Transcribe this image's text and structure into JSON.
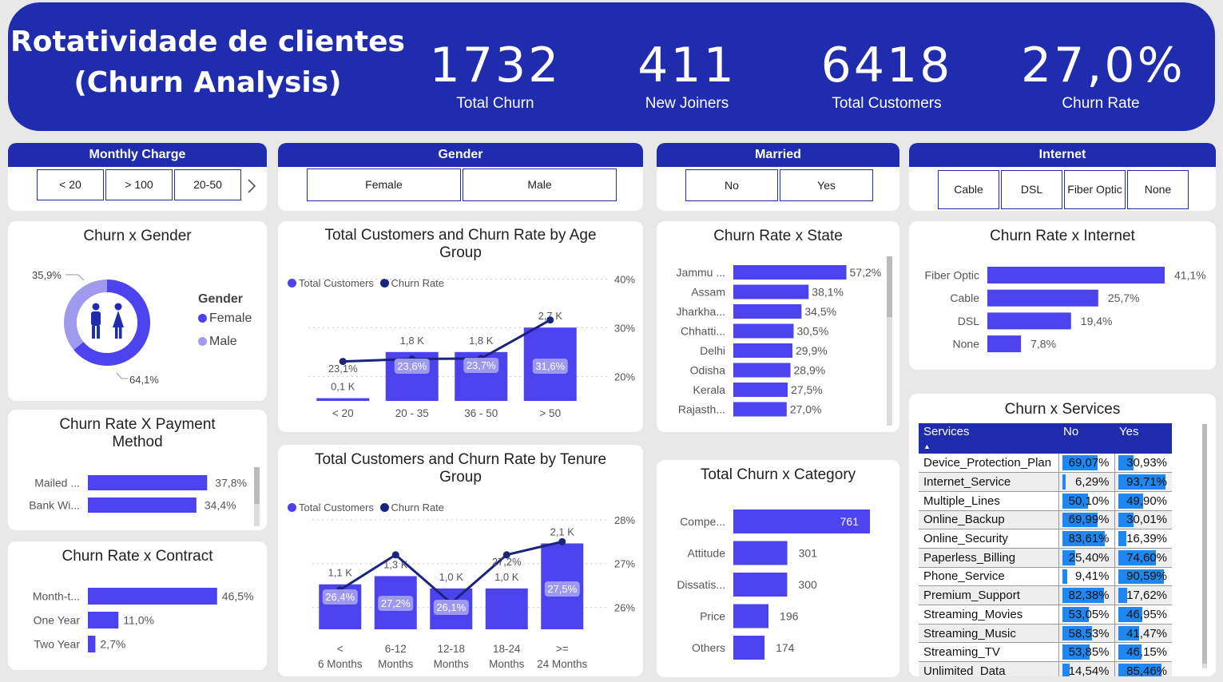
{
  "header": {
    "title_line1": "Rotatividade de clientes",
    "title_line2": "(Churn Analysis)",
    "kpis": [
      {
        "value": "1732",
        "label": "Total Churn"
      },
      {
        "value": "411",
        "label": "New Joiners"
      },
      {
        "value": "6418",
        "label": "Total Customers"
      },
      {
        "value": "27,0%",
        "label": "Churn Rate"
      }
    ]
  },
  "slicers": {
    "monthly_charge": {
      "title": "Monthly Charge",
      "options": [
        "< 20",
        "> 100",
        "20-50"
      ],
      "next_icon": "chevron-right-icon"
    },
    "gender": {
      "title": "Gender",
      "options": [
        "Female",
        "Male"
      ]
    },
    "married": {
      "title": "Married",
      "options": [
        "No",
        "Yes"
      ]
    },
    "internet": {
      "title": "Internet",
      "options": [
        "Cable",
        "DSL",
        "Fiber Optic",
        "None"
      ]
    }
  },
  "colors": {
    "primary": "#1f2cae",
    "bar": "#4c42ee",
    "light": "#9f9aee",
    "dark_line": "#1a237e",
    "table_bar": "#1f87f2"
  },
  "charts": {
    "churn_gender": {
      "title": "Churn x Gender",
      "legend_title": "Gender",
      "center_icon": "people-icon"
    },
    "age": {
      "title": "Total Customers and Churn Rate by Age Group"
    },
    "tenure": {
      "title": "Total Customers and Churn Rate by Tenure Group"
    },
    "payment": {
      "title": "Churn Rate X Payment Method"
    },
    "contract": {
      "title": "Churn Rate x Contract"
    },
    "state": {
      "title": "Churn Rate x State"
    },
    "internet": {
      "title": "Churn Rate x Internet"
    },
    "category": {
      "title": "Total Churn x Category"
    },
    "services": {
      "title": "Churn x Services"
    },
    "legend_total": "Total Customers",
    "legend_rate": "Churn Rate"
  },
  "chart_data": [
    {
      "id": "gender",
      "type": "pie",
      "title": "Churn x Gender",
      "categories": [
        "Female",
        "Male"
      ],
      "values": [
        64.1,
        35.9
      ],
      "labels": [
        "64,1%",
        "35,9%"
      ],
      "legend_title": "Gender",
      "legend": [
        "Female",
        "Male"
      ]
    },
    {
      "id": "age",
      "type": "bar",
      "title": "Total Customers and Churn Rate by Age Group",
      "categories": [
        "< 20",
        "20 - 35",
        "36 - 50",
        "> 50"
      ],
      "series": [
        {
          "name": "Total Customers",
          "values": [
            0.1,
            1.8,
            1.8,
            2.7
          ],
          "labels": [
            "0,1 K",
            "1,8 K",
            "1,8 K",
            "2,7 K"
          ]
        },
        {
          "name": "Churn Rate",
          "values": [
            23.1,
            23.6,
            23.7,
            31.6
          ],
          "labels": [
            "23,1%",
            "23,6%",
            "23,7%",
            "31,6%"
          ]
        }
      ],
      "y2_ticks": [
        "20%",
        "30%",
        "40%"
      ],
      "y2_tick_values": [
        20,
        30,
        40
      ],
      "y2lim": [
        15,
        45
      ],
      "ylim": [
        0,
        3
      ]
    },
    {
      "id": "tenure",
      "type": "bar",
      "title": "Total Customers and Churn Rate by Tenure Group",
      "categories": [
        "< 6 Months",
        "6-12 Months",
        "12-18 Months",
        "18-24 Months",
        ">= 24 Months"
      ],
      "series": [
        {
          "name": "Total Customers",
          "values": [
            1.1,
            1.3,
            1.0,
            1.0,
            2.1
          ],
          "labels": [
            "1,1 K",
            "1,3 K",
            "1,0 K",
            "1,0 K",
            "2,1 K"
          ]
        },
        {
          "name": "Churn Rate",
          "values": [
            26.4,
            27.2,
            26.1,
            27.2,
            27.5
          ],
          "labels": [
            "26,4%",
            "27,2%",
            "26,1%",
            "27,2%",
            "27,5%"
          ]
        }
      ],
      "y2_ticks": [
        "26%",
        "27%",
        "28%"
      ],
      "y2_tick_values": [
        26,
        27,
        28
      ],
      "y2lim": [
        25.5,
        28.6
      ],
      "ylim": [
        0,
        2.5
      ]
    },
    {
      "id": "payment",
      "type": "bar",
      "orientation": "horizontal",
      "title": "Churn Rate X Payment Method",
      "categories": [
        "Mailed ...",
        "Bank Wi..."
      ],
      "values": [
        37.8,
        34.4
      ],
      "labels": [
        "37,8%",
        "34,4%"
      ],
      "xlim": [
        0,
        40
      ]
    },
    {
      "id": "contract",
      "type": "bar",
      "orientation": "horizontal",
      "title": "Churn Rate x Contract",
      "categories": [
        "Month-t...",
        "One Year",
        "Two Year"
      ],
      "values": [
        46.5,
        11.0,
        2.7
      ],
      "labels": [
        "46,5%",
        "11,0%",
        "2,7%"
      ],
      "xlim": [
        0,
        48
      ]
    },
    {
      "id": "state",
      "type": "bar",
      "orientation": "horizontal",
      "title": "Churn Rate x State",
      "categories": [
        "Jammu ...",
        "Assam",
        "Jharkha...",
        "Chhatti...",
        "Delhi",
        "Odisha",
        "Kerala",
        "Rajasth..."
      ],
      "values": [
        57.2,
        38.1,
        34.5,
        30.5,
        29.9,
        28.9,
        27.5,
        27.0
      ],
      "labels": [
        "57,2%",
        "38,1%",
        "34,5%",
        "30,5%",
        "29,9%",
        "28,9%",
        "27,5%",
        "27,0%"
      ],
      "xlim": [
        0,
        59
      ]
    },
    {
      "id": "internet",
      "type": "bar",
      "orientation": "horizontal",
      "title": "Churn Rate x Internet",
      "categories": [
        "Fiber Optic",
        "Cable",
        "DSL",
        "None"
      ],
      "values": [
        41.1,
        25.7,
        19.4,
        7.8
      ],
      "labels": [
        "41,1%",
        "25,7%",
        "19,4%",
        "7,8%"
      ],
      "xlim": [
        0,
        41.1
      ]
    },
    {
      "id": "category",
      "type": "bar",
      "orientation": "horizontal",
      "title": "Total Churn x Category",
      "categories": [
        "Compe...",
        "Attitude",
        "Dissatis...",
        "Price",
        "Others"
      ],
      "values": [
        761,
        301,
        300,
        196,
        174
      ],
      "labels": [
        "761",
        "301",
        "300",
        "196",
        "174"
      ],
      "xlim": [
        0,
        761
      ]
    },
    {
      "id": "services",
      "type": "table",
      "title": "Churn x Services",
      "columns": [
        "Services",
        "No",
        "Yes"
      ],
      "rows": [
        {
          "service": "Device_Protection_Plan",
          "no": 69.07,
          "yes": 30.93,
          "no_label": "69,07%",
          "yes_label": "30,93%"
        },
        {
          "service": "Internet_Service",
          "no": 6.29,
          "yes": 93.71,
          "no_label": "6,29%",
          "yes_label": "93,71%"
        },
        {
          "service": "Multiple_Lines",
          "no": 50.1,
          "yes": 49.9,
          "no_label": "50,10%",
          "yes_label": "49,90%"
        },
        {
          "service": "Online_Backup",
          "no": 69.99,
          "yes": 30.01,
          "no_label": "69,99%",
          "yes_label": "30,01%"
        },
        {
          "service": "Online_Security",
          "no": 83.61,
          "yes": 16.39,
          "no_label": "83,61%",
          "yes_label": "16,39%"
        },
        {
          "service": "Paperless_Billing",
          "no": 25.4,
          "yes": 74.6,
          "no_label": "25,40%",
          "yes_label": "74,60%"
        },
        {
          "service": "Phone_Service",
          "no": 9.41,
          "yes": 90.59,
          "no_label": "9,41%",
          "yes_label": "90,59%"
        },
        {
          "service": "Premium_Support",
          "no": 82.38,
          "yes": 17.62,
          "no_label": "82,38%",
          "yes_label": "17,62%"
        },
        {
          "service": "Streaming_Movies",
          "no": 53.05,
          "yes": 46.95,
          "no_label": "53,05%",
          "yes_label": "46,95%"
        },
        {
          "service": "Streaming_Music",
          "no": 58.53,
          "yes": 41.47,
          "no_label": "58,53%",
          "yes_label": "41,47%"
        },
        {
          "service": "Streaming_TV",
          "no": 53.85,
          "yes": 46.15,
          "no_label": "53,85%",
          "yes_label": "46,15%"
        },
        {
          "service": "Unlimited_Data",
          "no": 14.54,
          "yes": 85.46,
          "no_label": "14,54%",
          "yes_label": "85,46%"
        }
      ]
    }
  ]
}
